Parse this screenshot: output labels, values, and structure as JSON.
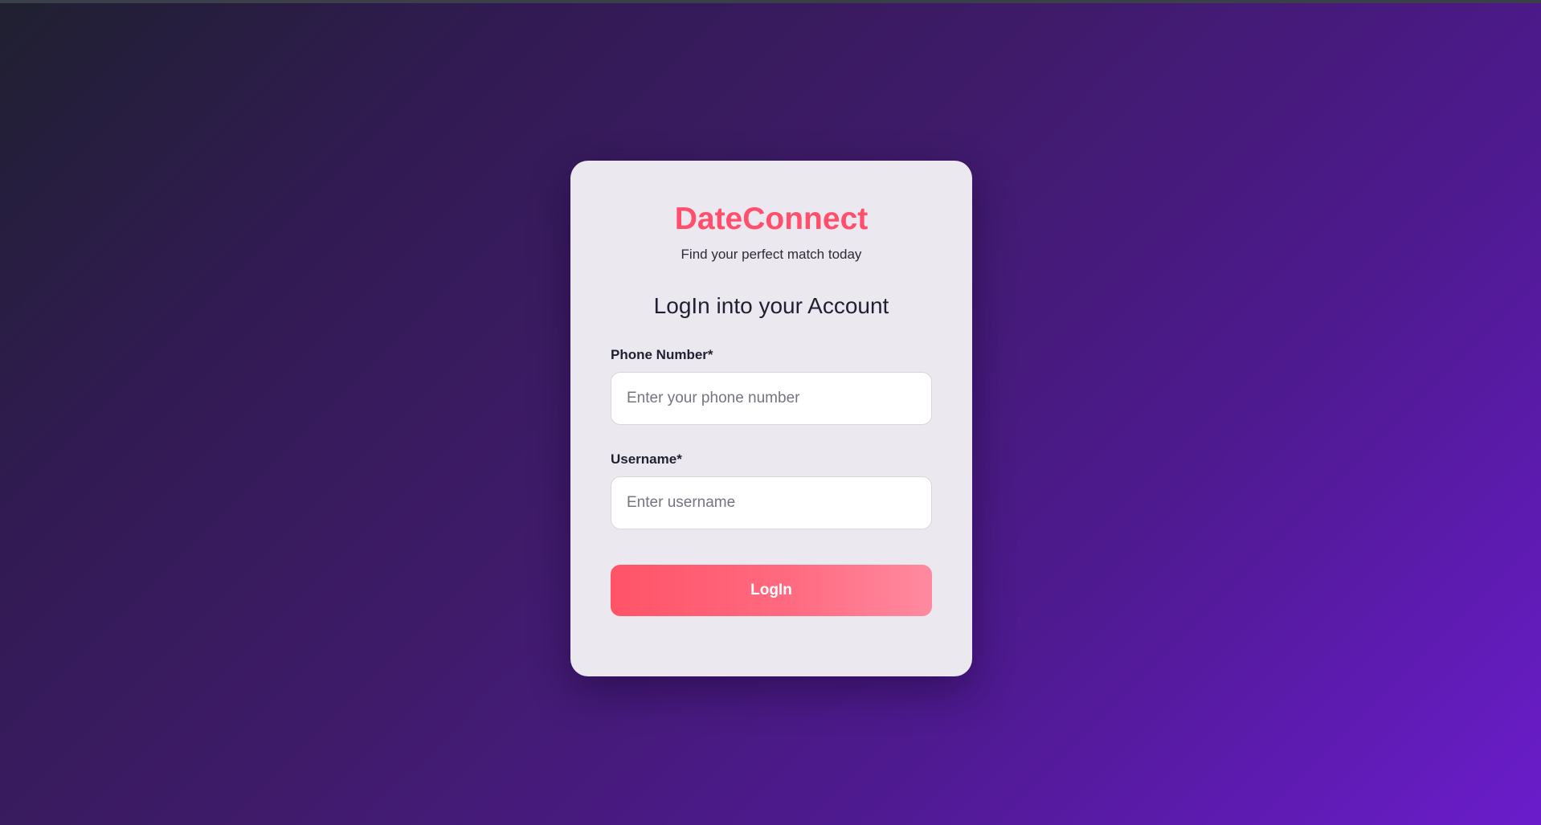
{
  "brand": {
    "name": "DateConnect",
    "tagline": "Find your perfect match today"
  },
  "form": {
    "heading": "LogIn into your Account",
    "phone": {
      "label": "Phone Number*",
      "placeholder": "Enter your phone number",
      "value": ""
    },
    "username": {
      "label": "Username*",
      "placeholder": "Enter username",
      "value": ""
    },
    "submit_label": "LogIn"
  },
  "colors": {
    "accent": "#ff4f6d",
    "card_background": "#ece8f0",
    "background_start": "#1f2030",
    "background_end": "#6a1ccb"
  }
}
